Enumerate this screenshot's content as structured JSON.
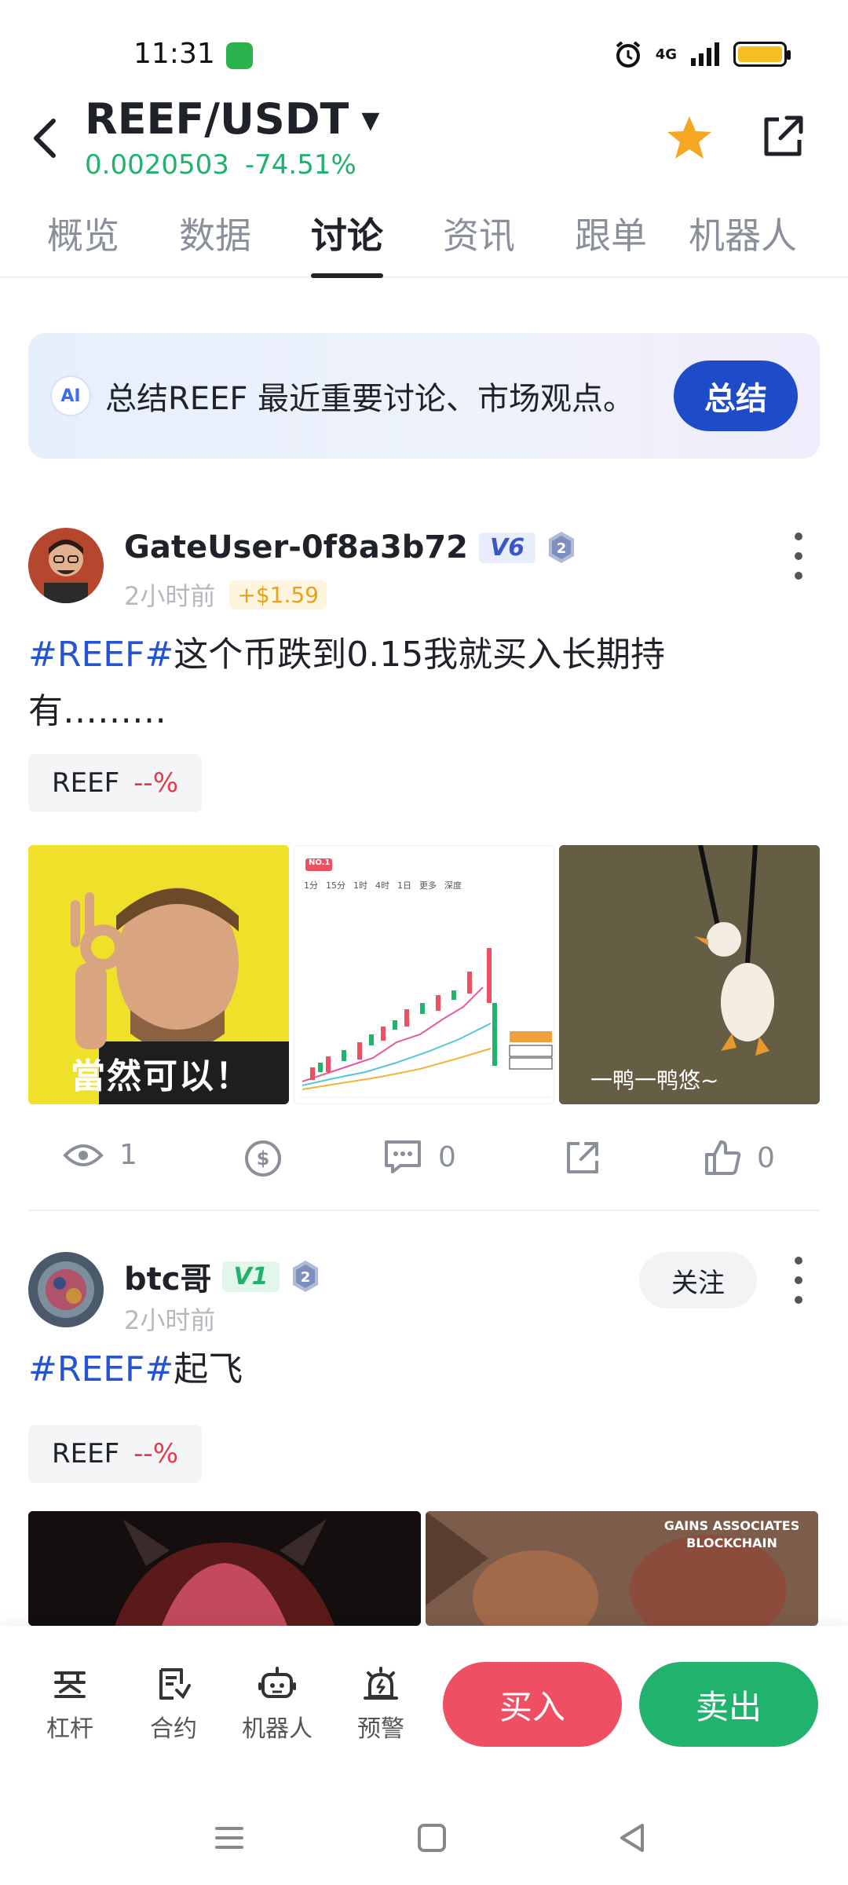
{
  "status_bar": {
    "time": "11:31",
    "network": "4G",
    "icons": [
      "alarm-icon",
      "signal-icon",
      "battery-icon"
    ]
  },
  "header": {
    "pair": "REEF/USDT",
    "price": "0.0020503",
    "change": "-74.51%",
    "price_color": "#20b26c",
    "favorite_color": "#f5a623"
  },
  "tabs": [
    {
      "label": "概览"
    },
    {
      "label": "数据"
    },
    {
      "label": "讨论"
    },
    {
      "label": "资讯"
    },
    {
      "label": "跟单"
    },
    {
      "label": "机器人"
    }
  ],
  "ai_card": {
    "badge": "AI",
    "text": "总结REEF 最近重要讨论、市场观点。",
    "button": "总结"
  },
  "posts": [
    {
      "username": "GateUser-0f8a3b72",
      "vip": "V6",
      "level": "2",
      "time": "2小时前",
      "pnl": "+$1.59",
      "hashtag": "#REEF#",
      "text_line1": "这个币跌到0.15我就买入长期持",
      "text_line2": "有………",
      "coin": "REEF",
      "coin_change": "--%",
      "images": [
        {
          "caption": "當然可以！"
        },
        {
          "caption": "NO.1",
          "tabs": [
            "1分",
            "15分",
            "1时",
            "4时",
            "1日",
            "更多",
            "深度"
          ]
        },
        {
          "caption": "一鸭一鸭悠~"
        }
      ],
      "views": "1",
      "comments": "0",
      "likes": "0"
    },
    {
      "username": "btc哥",
      "vip": "V1",
      "level": "2",
      "time": "2小时前",
      "follow": "关注",
      "hashtag": "#REEF#",
      "text": "起飞",
      "coin": "REEF",
      "coin_change": "--%",
      "images": [
        {
          "caption": ""
        },
        {
          "caption": "GAINS ASSOCIATES BLOCKCHAIN"
        }
      ]
    }
  ],
  "bottom_bar": {
    "items": [
      {
        "label": "杠杆",
        "icon": "leverage-icon"
      },
      {
        "label": "合约",
        "icon": "contract-icon"
      },
      {
        "label": "机器人",
        "icon": "robot-icon"
      },
      {
        "label": "预警",
        "icon": "alert-icon"
      }
    ],
    "buy": "买入",
    "sell": "卖出",
    "buy_color": "#ef4f63",
    "sell_color": "#21b26e"
  }
}
